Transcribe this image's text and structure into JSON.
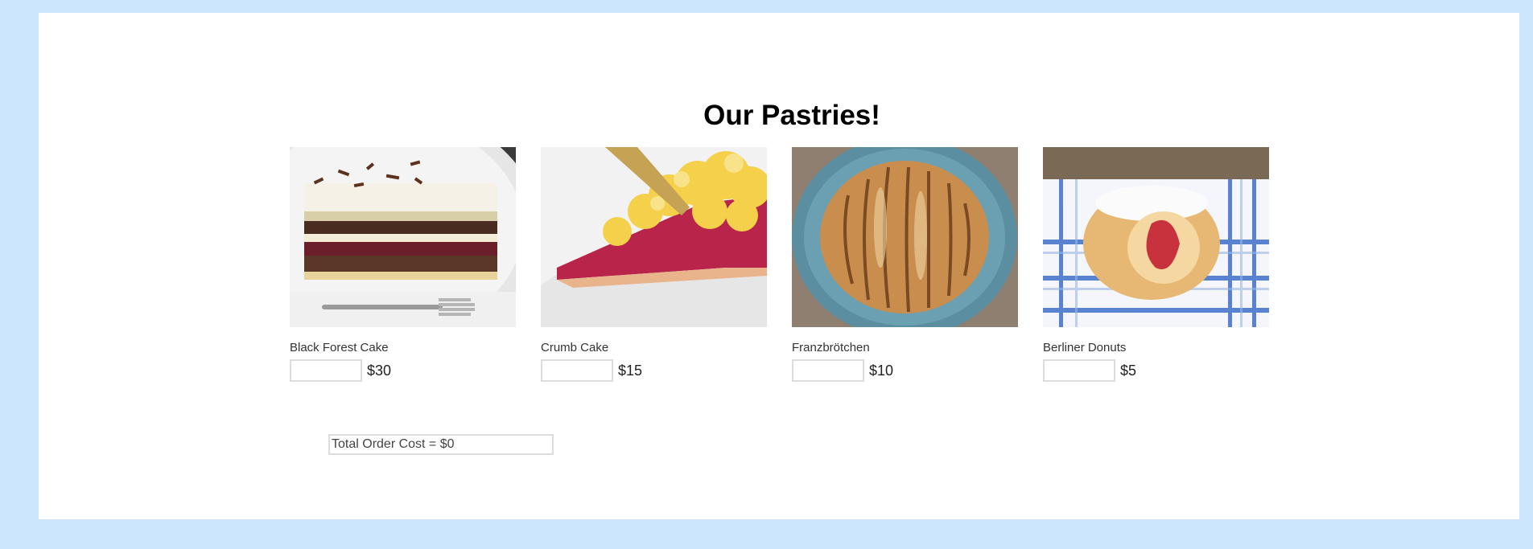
{
  "page": {
    "title": "Our Pastries!"
  },
  "products": [
    {
      "name": "Black Forest Cake",
      "price": "$30",
      "quantity": "",
      "image": "black-forest-cake-photo"
    },
    {
      "name": "Crumb Cake",
      "price": "$15",
      "quantity": "",
      "image": "crumb-cake-photo"
    },
    {
      "name": "Franzbrötchen",
      "price": "$10",
      "quantity": "",
      "image": "franzbrotchen-photo"
    },
    {
      "name": "Berliner Donuts",
      "price": "$5",
      "quantity": "",
      "image": "berliner-donut-photo"
    }
  ],
  "order": {
    "total_text": "Total Order Cost = $0"
  },
  "colors": {
    "page_background": "#cbe6fd",
    "panel_background": "#ffffff"
  }
}
